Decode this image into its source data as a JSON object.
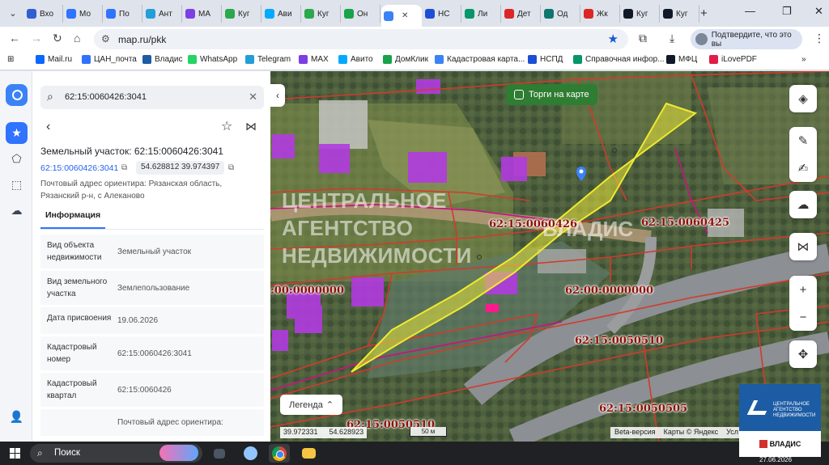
{
  "browser": {
    "tabs": [
      {
        "label": "Вхо",
        "color": "#2f5fd0",
        "active": false
      },
      {
        "label": "Мо",
        "color": "#2f73ff",
        "active": false
      },
      {
        "label": "По",
        "color": "#2f73ff",
        "active": false
      },
      {
        "label": "Ант",
        "color": "#229ed9",
        "active": false
      },
      {
        "label": "МА",
        "color": "#7b3fe4",
        "active": false
      },
      {
        "label": "Куг",
        "color": "#2aa84a",
        "active": false
      },
      {
        "label": "Ави",
        "color": "#00aaff",
        "active": false
      },
      {
        "label": "Куг",
        "color": "#2aa84a",
        "active": false
      },
      {
        "label": "Он",
        "color": "#16a34a",
        "active": false
      },
      {
        "label": "",
        "color": "#3b82f6",
        "active": true
      },
      {
        "label": "НС",
        "color": "#1d4ed8",
        "active": false
      },
      {
        "label": "Ли",
        "color": "#059669",
        "active": false
      },
      {
        "label": "Дет",
        "color": "#dc2626",
        "active": false
      },
      {
        "label": "Од",
        "color": "#0f766e",
        "active": false
      },
      {
        "label": "Жк",
        "color": "#dc2626",
        "active": false
      },
      {
        "label": "Куг",
        "color": "#111827",
        "active": false
      },
      {
        "label": "Куг",
        "color": "#111827",
        "active": false
      }
    ],
    "new_tab": "+",
    "url": "map.ru/pkk",
    "profile_label": "Подтвердите, что это вы",
    "bookmarks": [
      {
        "label": "Mail.ru",
        "color": "#0a66ff"
      },
      {
        "label": "ЦАН_почта",
        "color": "#2f73ff"
      },
      {
        "label": "Владис",
        "color": "#1c5ca5"
      },
      {
        "label": "WhatsApp",
        "color": "#25d366"
      },
      {
        "label": "Telegram",
        "color": "#229ed9"
      },
      {
        "label": "MAX",
        "color": "#7b3fe4"
      },
      {
        "label": "Авито",
        "color": "#00aaff"
      },
      {
        "label": "ДомКлик",
        "color": "#16a34a"
      },
      {
        "label": "Кадастровая карта...",
        "color": "#3b82f6"
      },
      {
        "label": "НСПД",
        "color": "#1d4ed8"
      },
      {
        "label": "Справочная инфор...",
        "color": "#059669"
      },
      {
        "label": "МФЦ",
        "color": "#111827"
      },
      {
        "label": "iLovePDF",
        "color": "#e11d48"
      }
    ]
  },
  "panel": {
    "search_value": "62:15:0060426:3041",
    "title": "Земельный участок: 62:15:0060426:3041",
    "cadastral_link": "62:15:0060426:3041",
    "coordinates": "54.628812 39.974397",
    "address": "Почтовый адрес ориентира: Рязанская область, Рязанский р-н, с Алеканово",
    "tab_label": "Информация",
    "rows": [
      {
        "key": "Вид объекта недвижимости",
        "value": "Земельный участок"
      },
      {
        "key": "Вид земельного участка",
        "value": "Землепользование"
      },
      {
        "key": "Дата присвоения",
        "value": "19.06.2026"
      },
      {
        "key": "Кадастровый номер",
        "value": "62:15:0060426:3041"
      },
      {
        "key": "Кадастровый квартал",
        "value": "62:15:0060426"
      },
      {
        "key": "",
        "value": "Почтовый адрес ориентира:"
      }
    ]
  },
  "map": {
    "auction_label": "Торги на карте",
    "legend_label": "Легенда",
    "coords_lon": "39.972331",
    "coords_lat": "54.628923",
    "scale_label": "50 м",
    "beta": "Beta-версия",
    "copyright": "Карты © Яндекс",
    "copyright_more": "Усл",
    "watermark": "ЦЕНТРАЛЬНОЕ АГЕНТСТВО НЕДВИЖИМОСТИ",
    "watermark_brand": "ВЛАДИС",
    "quarter_labels": [
      "62:15:0060426",
      "62:15:0060425",
      ":00:0000000",
      "62:00:0000000",
      "62:15:0050510",
      "62:15:0050505",
      "62:15:0050510"
    ]
  },
  "vladis": {
    "org_text": "ЦЕНТРАЛЬНОЕ АГЕНТСТВО НЕДВИЖИМОСТИ",
    "brand": "ВЛАДИС",
    "date": "27.06.2026"
  },
  "taskbar": {
    "search_label": "Поиск"
  },
  "colors": {
    "accent": "#2f73ff",
    "parcel": "#e8e33a",
    "boundary": "#d33a2c",
    "building": "#b13be0",
    "auction": "#2e7d32"
  }
}
